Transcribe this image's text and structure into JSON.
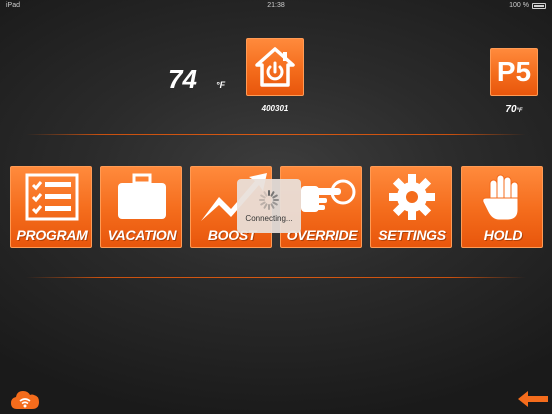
{
  "status_bar": {
    "carrier": "iPad",
    "time": "21:38",
    "battery": "100 %"
  },
  "thermostat": {
    "current_temp": "74",
    "current_unit": "°F",
    "device_id": "400301",
    "program_badge": "P5",
    "setpoint_temp": "70",
    "setpoint_unit": "°F"
  },
  "buttons": [
    {
      "label": "PROGRAM",
      "icon": "checklist-icon"
    },
    {
      "label": "VACATION",
      "icon": "suitcase-icon"
    },
    {
      "label": "BOOST",
      "icon": "boost-arrow-icon"
    },
    {
      "label": "OVERRIDE",
      "icon": "pointing-hand-icon"
    },
    {
      "label": "SETTINGS",
      "icon": "gear-icon"
    },
    {
      "label": "HOLD",
      "icon": "hand-stop-icon"
    }
  ],
  "overlay": {
    "text": "Connecting..."
  },
  "icons": {
    "home": "home-power-icon",
    "cloud": "cloud-wifi-icon",
    "back": "back-arrow-icon"
  },
  "colors": {
    "accent": "#f46c1c",
    "background": "#2b2b2b",
    "divider": "#d85a14"
  }
}
